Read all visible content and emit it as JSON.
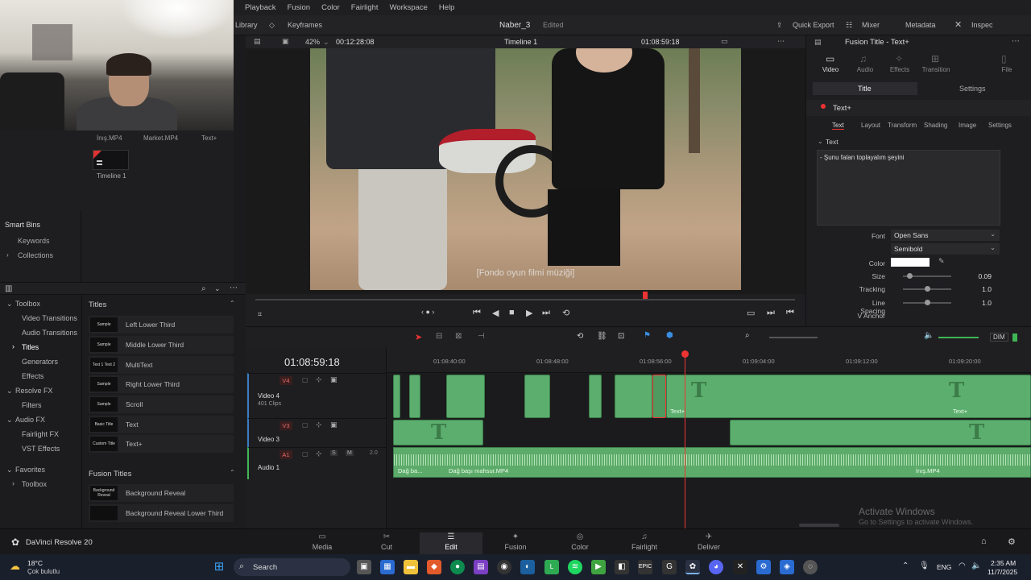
{
  "menu": [
    "Playback",
    "Fusion",
    "Color",
    "Fairlight",
    "Workspace",
    "Help"
  ],
  "toolbar": {
    "library": "Library",
    "keyframes": "Keyframes",
    "project_title": "Naber_3",
    "project_state": "Edited",
    "quick_export": "Quick Export",
    "mixer": "Mixer",
    "metadata": "Metadata",
    "inspector": "Inspec"
  },
  "viewer_bar": {
    "zoom": "42%",
    "source_tc": "00:12:28:08",
    "timeline_name": "Timeline 1",
    "record_tc": "01:08:59:18"
  },
  "subtitle": "[Fondo oyun filmi müziği]",
  "media_pool": {
    "clips": [
      "İnış.MP4",
      "Market.MP4",
      "Text+"
    ],
    "timeline": "Timeline 1"
  },
  "bins": {
    "smart_bins": "Smart Bins",
    "items": [
      "Keywords",
      "Collections"
    ]
  },
  "effects": {
    "tree": [
      "Toolbox",
      "Video Transitions",
      "Audio Transitions",
      "Titles",
      "Generators",
      "Effects",
      "Resolve FX",
      "Filters",
      "Audio FX",
      "Fairlight FX",
      "VST Effects",
      "Favorites",
      "Toolbox"
    ],
    "titles_header": "Titles",
    "titles": [
      {
        "thumb": "Sample",
        "name": "Left Lower Third"
      },
      {
        "thumb": "Sample",
        "name": "Middle Lower Third"
      },
      {
        "thumb": "Text 1 Text 2",
        "name": "MultiText"
      },
      {
        "thumb": "Sample",
        "name": "Right Lower Third"
      },
      {
        "thumb": "Sample",
        "name": "Scroll"
      },
      {
        "thumb": "Basic Title",
        "name": "Text"
      },
      {
        "thumb": "Custom Title",
        "name": "Text+"
      }
    ],
    "fusion_header": "Fusion Titles",
    "fusion_titles": [
      {
        "thumb": "Background Reveal",
        "name": "Background Reveal"
      },
      {
        "thumb": "",
        "name": "Background Reveal Lower Third"
      }
    ]
  },
  "inspector": {
    "title": "Fusion Title - Text+",
    "tabs": [
      "Video",
      "Audio",
      "Effects",
      "Transition",
      "File"
    ],
    "sub_tabs": [
      "Title",
      "Settings"
    ],
    "node": "Text+",
    "node_tabs": [
      "Text",
      "Layout",
      "Transform",
      "Shading",
      "Image",
      "Settings"
    ],
    "section": "Text",
    "text_value": "- Şunu falan toplayalım şeyini",
    "font_label": "Font",
    "font": "Open Sans",
    "weight": "Semibold",
    "color_label": "Color",
    "props": [
      {
        "label": "Size",
        "value": "0.09",
        "level": 0.09
      },
      {
        "label": "Tracking",
        "value": "1.0",
        "level": 0.5
      },
      {
        "label": "Line Spacing",
        "value": "1.0",
        "level": 0.5
      },
      {
        "label": "V Anchor",
        "value": ""
      }
    ]
  },
  "timeline": {
    "timecode": "01:08:59:18",
    "ruler": [
      "01:08:40:00",
      "01:08:48:00",
      "01:08:56:00",
      "01:09:04:00",
      "01:09:12:00",
      "01:09:20:00"
    ],
    "tracks": [
      {
        "id": "V4",
        "name": "Video 4",
        "sub": "401 Clips"
      },
      {
        "id": "V3",
        "name": "Video 3",
        "sub": ""
      },
      {
        "id": "A1",
        "name": "Audio 1",
        "sub": "2.0"
      }
    ],
    "clip_labels": [
      "Text+",
      "Text+",
      "Dağ ba...",
      "Dağ başı mahsur.MP4",
      "İnış.MP4"
    ],
    "dim": "DIM"
  },
  "watermark": {
    "line1": "Activate Windows",
    "line2": "Go to Settings to activate Windows."
  },
  "pages": [
    "Media",
    "Cut",
    "Edit",
    "Fusion",
    "Color",
    "Fairlight",
    "Deliver"
  ],
  "active_page": "Edit",
  "app_name": "DaVinci Resolve 20",
  "taskbar": {
    "weather_temp": "18°C",
    "weather_desc": "Çok bulutlu",
    "search": "Search",
    "lang": "ENG",
    "time": "2:35 AM",
    "date": "11/7/2025"
  }
}
